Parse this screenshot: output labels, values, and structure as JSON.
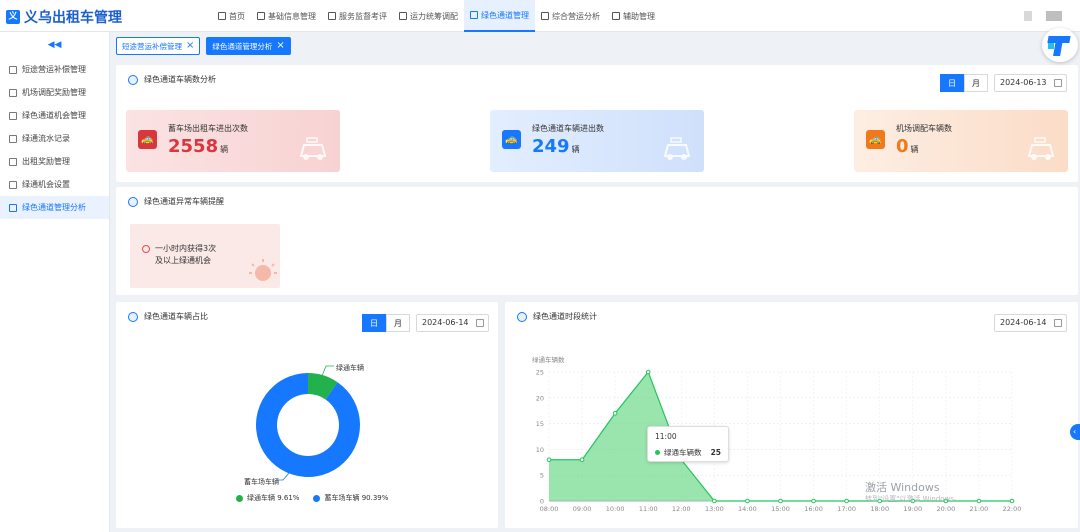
{
  "app": {
    "title": "义乌出租车管理",
    "logo_char": "义"
  },
  "nav": [
    {
      "label": "首页"
    },
    {
      "label": "基础信息管理"
    },
    {
      "label": "服务监督考评"
    },
    {
      "label": "运力统筹调配"
    },
    {
      "label": "绿色通道管理"
    },
    {
      "label": "综合营运分析"
    },
    {
      "label": "辅助管理"
    }
  ],
  "sidebar": {
    "collapse": "◀◀",
    "items": [
      {
        "label": "短途营运补偿管理"
      },
      {
        "label": "机场调配奖励管理"
      },
      {
        "label": "绿色通道机会管理"
      },
      {
        "label": "绿通流水记录"
      },
      {
        "label": "出租奖励管理"
      },
      {
        "label": "绿通机会设置"
      },
      {
        "label": "绿色通道管理分析"
      }
    ]
  },
  "tabs": [
    {
      "label": "短途营运补偿管理",
      "close": "×"
    },
    {
      "label": "绿色通道管理分析",
      "close": "×"
    }
  ],
  "panel1": {
    "title": "绿色通道车辆数分析",
    "seg_day": "日",
    "seg_month": "月",
    "date": "2024-06-13",
    "cards": [
      {
        "label": "蓄车场出租车进出次数",
        "value": "2558",
        "unit": "辆",
        "color": "#d9363e",
        "icon": "taxi-icon"
      },
      {
        "label": "绿色通道车辆进出数",
        "value": "249",
        "unit": "辆",
        "color": "#1677ff",
        "icon": "taxi-icon"
      },
      {
        "label": "机场调配车辆数",
        "value": "0",
        "unit": "辆",
        "color": "#f07a1b",
        "icon": "taxi-icon"
      }
    ]
  },
  "panel2": {
    "title": "绿色通道异常车辆提醒",
    "warn_line1": "一小时内获得3次",
    "warn_line2": "及以上绿通机会"
  },
  "panel3": {
    "title": "绿色通道车辆占比",
    "seg_day": "日",
    "seg_month": "月",
    "date": "2024-06-14",
    "label_green": "绿通车辆",
    "label_blue": "蓄车场车辆",
    "legend_green": "绿通车辆 9.61%",
    "legend_blue": "蓄车场车辆 90.39%"
  },
  "panel4": {
    "title": "绿色通道时段统计",
    "date": "2024-06-14",
    "tooltip_time": "11:00",
    "tooltip_name": "绿通车辆数",
    "tooltip_value": "25"
  },
  "watermark": {
    "line1": "激活 Windows",
    "line2": "转到\"设置\"以激活 Windows。"
  },
  "chart_data": [
    {
      "type": "pie",
      "title": "绿色通道车辆占比",
      "categories": [
        "绿通车辆",
        "蓄车场车辆"
      ],
      "values": [
        9.61,
        90.39
      ],
      "colors": [
        "#22b14c",
        "#1677ff"
      ],
      "legend": "bottom"
    },
    {
      "type": "area",
      "title": "绿色通道时段统计",
      "ylabel": "绿通车辆数",
      "x": [
        "08:00",
        "09:00",
        "10:00",
        "11:00",
        "12:00",
        "13:00",
        "14:00",
        "15:00",
        "16:00",
        "17:00",
        "18:00",
        "19:00",
        "20:00",
        "21:00",
        "22:00"
      ],
      "series": [
        {
          "name": "绿通车辆数",
          "values": [
            8,
            8,
            17,
            25,
            8,
            0,
            0,
            0,
            0,
            0,
            0,
            0,
            0,
            0,
            0
          ],
          "color": "#22c55e"
        }
      ],
      "ylim": [
        0,
        25
      ],
      "yticks": [
        0,
        5,
        10,
        15,
        20,
        25
      ],
      "grid": true
    }
  ]
}
